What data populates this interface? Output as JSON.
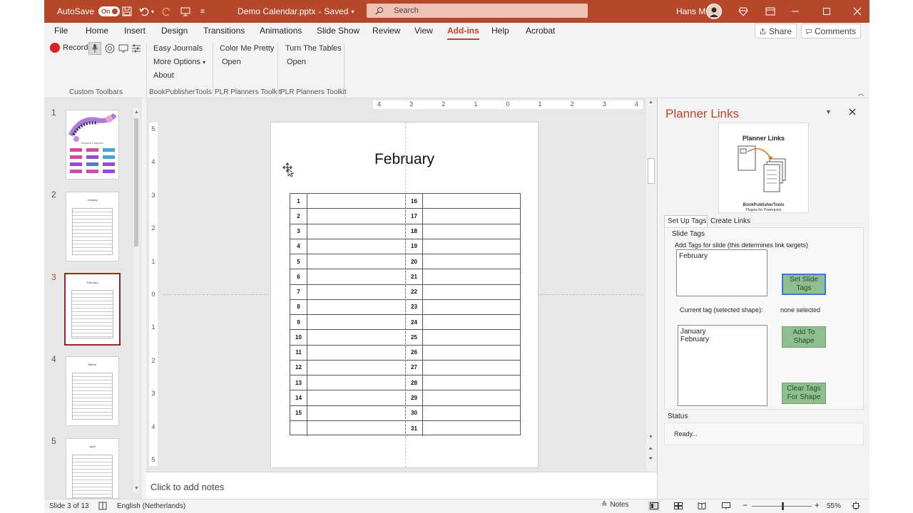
{
  "titlebar": {
    "autosave_label": "AutoSave",
    "autosave_state": "On",
    "filename": "Demo Calendar.pptx",
    "save_status": "Saved",
    "search_placeholder": "Search",
    "user_name": "Hans M"
  },
  "menu": {
    "tabs": [
      "File",
      "Home",
      "Insert",
      "Design",
      "Transitions",
      "Animations",
      "Slide Show",
      "Review",
      "View",
      "Add-ins",
      "Help",
      "Acrobat"
    ],
    "share_label": "Share",
    "comments_label": "Comments"
  },
  "ribbon": {
    "record_label": "Record",
    "group1_label": "Custom Toolbars",
    "g2_items": [
      "Easy Journals",
      "More Options",
      "About"
    ],
    "group2_label": "BookPublisherTools",
    "g3_items": [
      "Color Me Pretty",
      "Open"
    ],
    "group3_label": "PLR Planners Toolkit",
    "g4_items": [
      "Turn The Tables",
      "Open"
    ],
    "group4_label": "PLR Planners Toolkit"
  },
  "thumbnails": {
    "numbers": [
      "1",
      "2",
      "3",
      "4",
      "5"
    ],
    "titles": [
      "",
      "January",
      "February",
      "March",
      "April"
    ],
    "slide1_caption": "Musical Calendar"
  },
  "slide": {
    "title": "February",
    "left_days": [
      "1",
      "2",
      "3",
      "4",
      "5",
      "6",
      "7",
      "8",
      "9",
      "10",
      "11",
      "12",
      "13",
      "14",
      "15",
      ""
    ],
    "right_days": [
      "16",
      "17",
      "18",
      "19",
      "20",
      "21",
      "22",
      "23",
      "24",
      "25",
      "26",
      "27",
      "28",
      "29",
      "30",
      "31"
    ]
  },
  "rulers": {
    "h_ticks": [
      "4",
      "3",
      "2",
      "1",
      "0",
      "1",
      "2",
      "3",
      "4"
    ],
    "v_ticks": [
      "5",
      "4",
      "3",
      "2",
      "1",
      "0",
      "1",
      "2",
      "3",
      "4",
      "5"
    ]
  },
  "notes_placeholder": "Click to add notes",
  "status": {
    "slide_info": "Slide 3 of 13",
    "language": "English (Netherlands)",
    "notes_label": "Notes",
    "zoom": "55%",
    "zoom_fraction": 0.55
  },
  "pane": {
    "title": "Planner Links",
    "logo_title": "Planner Links",
    "logo_brand": "BookPublisherTools",
    "logo_sub": "Plugins for Powerpoint",
    "tab_setup": "Set Up Tags",
    "tab_links": "Create Links",
    "slide_tags_label": "Slide Tags",
    "add_tags_hint": "Add Tags for slide (this determines link targets)",
    "slide_tag_value": "February",
    "set_slide_tags_btn": "Set Slide Tags",
    "current_tag_label": "Current tag (selected shape):",
    "current_tag_value": "none selected",
    "tag_list": [
      "January",
      "February"
    ],
    "add_to_shape_btn": "Add To Shape",
    "clear_tags_btn": "Clear Tags For Shape",
    "status_label": "Status",
    "status_value": "Ready..."
  },
  "colors": {
    "accent": "#b7472a",
    "selected_thumb": "#8e2a1f",
    "button_green": "#8fbf8f"
  }
}
